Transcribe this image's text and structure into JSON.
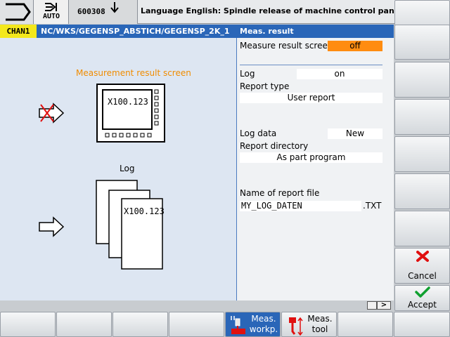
{
  "topbar": {
    "mode_label": "AUTO",
    "program_number": "600308",
    "alarm_text": "Language English: Spindle release of machine control panel is missing"
  },
  "pathbar": {
    "channel": "CHAN1",
    "path": "NC/WKS/GEGENSP_ABSTICH/GEGENSP_2K_1",
    "title": "Meas. result"
  },
  "illustration": {
    "screen_heading": "Measurement result screen",
    "screen_value": "X100.123",
    "log_heading": "Log",
    "log_value": "X100.123"
  },
  "form": {
    "measure_result_screen_label": "Measure result scree",
    "measure_result_screen_value": "off",
    "log_label": "Log",
    "log_value": "on",
    "report_type_label": "Report type",
    "report_type_value": "User report",
    "log_data_label": "Log data",
    "log_data_value": "New",
    "report_directory_label": "Report directory",
    "report_directory_value": "As part program",
    "report_file_label": "Name of report file",
    "report_file_value": "MY_LOG_DATEN",
    "report_file_ext": ".TXT"
  },
  "scroll": {
    "right_arrow": ">"
  },
  "vertical_softkeys": {
    "cancel_label": "Cancel",
    "accept_label": "Accept"
  },
  "horizontal_softkeys": {
    "meas_workp_line1": "Meas.",
    "meas_workp_line2": "workp.",
    "meas_tool_line1": "Meas.",
    "meas_tool_line2": "tool"
  },
  "colors": {
    "accent_blue": "#2a66b8",
    "channel_yellow": "#f4e81c",
    "orange_field": "#ff8c10",
    "cancel_red": "#e01010",
    "accept_green": "#10a030"
  }
}
